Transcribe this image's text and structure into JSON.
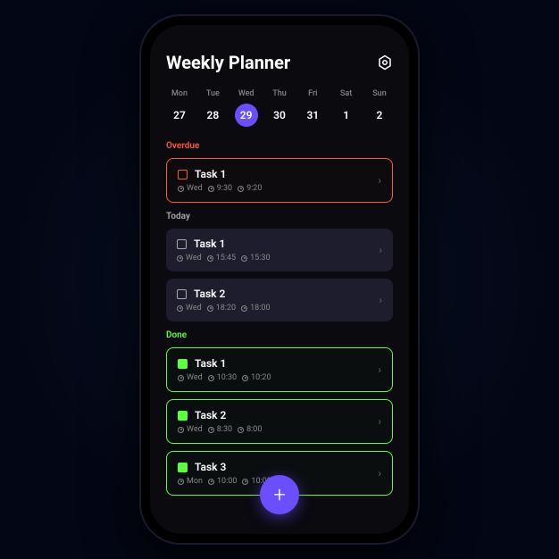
{
  "header": {
    "title": "Weekly Planner"
  },
  "colors": {
    "accent": "#6b4eff",
    "overdue": "#ff5a3c",
    "done": "#5cff3c"
  },
  "week": [
    {
      "name": "Mon",
      "num": "27",
      "selected": false
    },
    {
      "name": "Tue",
      "num": "28",
      "selected": false
    },
    {
      "name": "Wed",
      "num": "29",
      "selected": true
    },
    {
      "name": "Thu",
      "num": "30",
      "selected": false
    },
    {
      "name": "Fri",
      "num": "31",
      "selected": false
    },
    {
      "name": "Sat",
      "num": "1",
      "selected": false
    },
    {
      "name": "Sun",
      "num": "2",
      "selected": false
    }
  ],
  "sections": {
    "overdue": {
      "label": "Overdue",
      "tasks": [
        {
          "title": "Task 1",
          "day": "Wed",
          "time1": "9:30",
          "time2": "9:20"
        }
      ]
    },
    "today": {
      "label": "Today",
      "tasks": [
        {
          "title": "Task 1",
          "day": "Wed",
          "time1": "15:45",
          "time2": "15:30"
        },
        {
          "title": "Task 2",
          "day": "Wed",
          "time1": "18:20",
          "time2": "18:00"
        }
      ]
    },
    "done": {
      "label": "Done",
      "tasks": [
        {
          "title": "Task 1",
          "day": "Wed",
          "time1": "10:30",
          "time2": "10:20"
        },
        {
          "title": "Task 2",
          "day": "Wed",
          "time1": "8:30",
          "time2": "8:00"
        },
        {
          "title": "Task 3",
          "day": "Mon",
          "time1": "10:00",
          "time2": "10:00"
        }
      ]
    }
  }
}
